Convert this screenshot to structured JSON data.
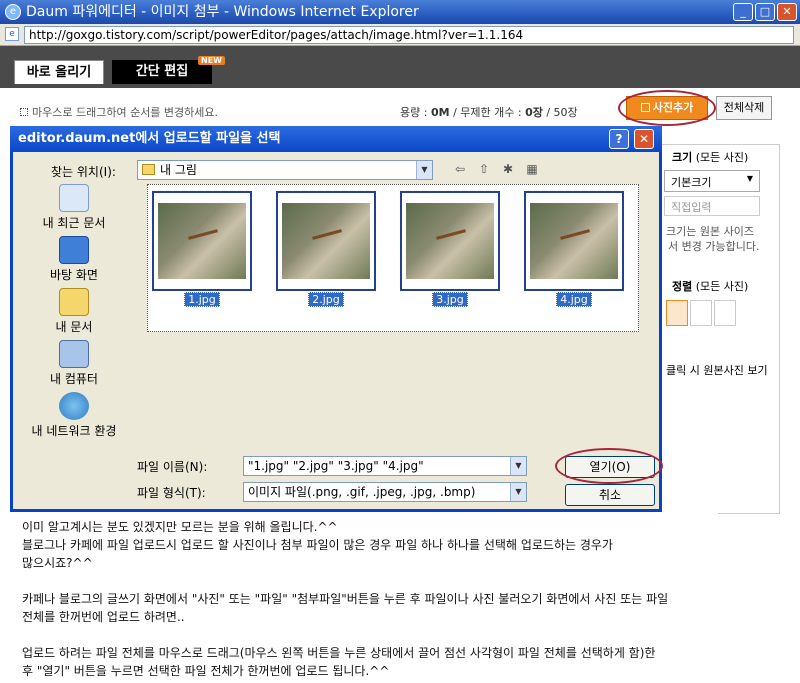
{
  "browser": {
    "title": "Daum 파워에디터 - 이미지 첨부 - Windows Internet Explorer",
    "url": "http://goxgo.tistory.com/script/powerEditor/pages/attach/image.html?ver=1.1.164",
    "min": "_",
    "max": "□",
    "close": "✕"
  },
  "editor": {
    "tabs": [
      {
        "label": "바로 올리기"
      },
      {
        "label": "간단 편집"
      }
    ],
    "new_badge": "NEW",
    "hint": "마우스로 드래그하여 순서를 변경하세요.",
    "capacity_label": "용량 :",
    "capacity_value": "0M",
    "capacity_sep": "/ 무제한  개수 :",
    "count_value": "0장",
    "count_max": "/ 50장",
    "add_photo": "사진추가",
    "delete_all": "전체삭제",
    "options": {
      "size_label": "크기",
      "size_scope": "(모든 사진)",
      "size_value": "기본크기",
      "size_input": "직접입력",
      "size_note_1": "크기는 원본 사이즈",
      "size_note_2": "서 변경 가능합니다.",
      "align_label": "정렬",
      "align_scope": "(모든 사진)",
      "click_note": "클릭 시 원본사진 보기"
    }
  },
  "dialog": {
    "title": "editor.daum.net에서 업로드할 파일을 선택",
    "help": "?",
    "close": "✕",
    "lookin_label": "찾는 위치(I):",
    "lookin_value": "내 그림",
    "places": [
      {
        "label": "내 최근 문서"
      },
      {
        "label": "바탕 화면"
      },
      {
        "label": "내 문서"
      },
      {
        "label": "내 컴퓨터"
      },
      {
        "label": "내 네트워크 환경"
      }
    ],
    "files": [
      {
        "name": "1.jpg"
      },
      {
        "name": "2.jpg"
      },
      {
        "name": "3.jpg"
      },
      {
        "name": "4.jpg"
      }
    ],
    "filename_label": "파일 이름(N):",
    "filename_value": "\"1.jpg\" \"2.jpg\" \"3.jpg\" \"4.jpg\"",
    "filetype_label": "파일 형식(T):",
    "filetype_value": "이미지 파일(.png, .gif, .jpeg, .jpg, .bmp)",
    "open_button": "열기(O)",
    "cancel_button": "취소"
  },
  "article": {
    "lines": [
      "이미 알고계시는 분도 있겠지만 모르는 분을 위해 올립니다.^^",
      "블로그나 카페에 파일 업로드시 업로드 할 사진이나 첨부 파일이 많은 경우 파일 하나 하나를 선택해 업로드하는 경우가",
      "많으시죠?^^",
      "",
      "카페나 블로그의 글쓰기 화면에서 \"사진\" 또는 \"파일\" \"첨부파일\"버튼을 누른 후 파일이나 사진 불러오기 화면에서 사진 또는 파일",
      "전체를 한꺼번에 업로드 하려면..",
      "",
      "업로드 하려는 파일 전체를  마우스로 드래그(마우스 왼쪽 버튼을 누른 상태에서 끌어 점선 사각형이 파일 전체를 선택하게 함)한",
      "후 \"열기\" 버튼을 누르면 선택한 파일 전체가 한꺼번에 업로드 됩니다.^^"
    ]
  },
  "colors": {
    "accent": "#0842c8",
    "orange": "#f08a1e",
    "highlight": "#a8243a"
  }
}
